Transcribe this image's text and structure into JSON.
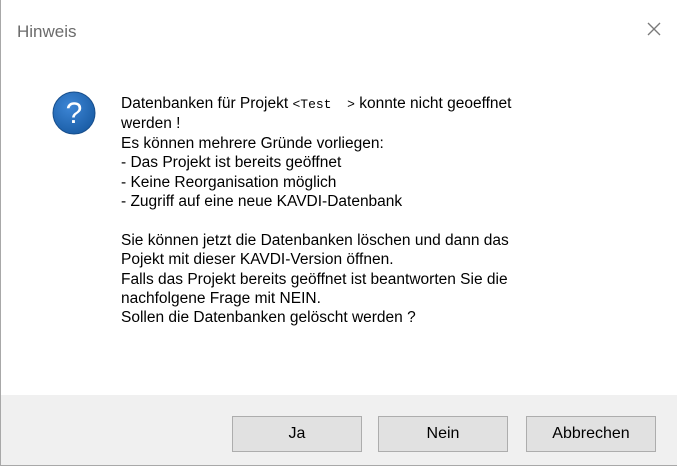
{
  "window": {
    "title": "Hinweis",
    "close_icon": "close-icon"
  },
  "message": {
    "icon": "question-icon",
    "line1_prefix": "Datenbanken für Projekt ",
    "project_token": "<Test  >",
    "line1_suffix": " konnte nicht geoeffnet",
    "lines_part1": "werden !\nEs können mehrere Gründe vorliegen:\n- Das Projekt ist bereits geöffnet\n- Keine Reorganisation möglich\n- Zugriff auf eine neue KAVDI-Datenbank",
    "lines_part2": "Sie können jetzt die Datenbanken löschen und dann das\nPojekt mit dieser KAVDI-Version öffnen.\nFalls das Projekt bereits geöffnet ist beantworten Sie die\nnachfolgene Frage mit NEIN.\nSollen die Datenbanken gelöscht werden ?"
  },
  "buttons": {
    "yes_label": "Ja",
    "no_label": "Nein",
    "cancel_label": "Abbrechen"
  },
  "colors": {
    "icon_blue": "#1c5fa8",
    "footer_bg": "#f0f0f0",
    "button_bg": "#e1e1e1"
  }
}
